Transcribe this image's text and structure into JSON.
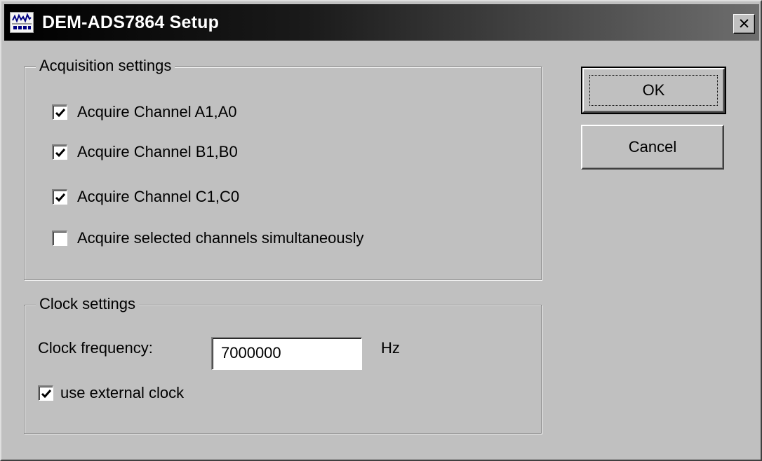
{
  "window": {
    "title": "DEM-ADS7864 Setup",
    "close_glyph": "✕"
  },
  "acquisition": {
    "legend": "Acquisition settings",
    "checkboxes": [
      {
        "label": "Acquire Channel A1,A0",
        "checked": true
      },
      {
        "label": "Acquire Channel B1,B0",
        "checked": true
      },
      {
        "label": "Acquire Channel C1,C0",
        "checked": true
      },
      {
        "label": "Acquire selected channels simultaneously",
        "checked": false
      }
    ]
  },
  "clock": {
    "legend": "Clock settings",
    "frequency_label": "Clock frequency:",
    "frequency_value": "7000000",
    "unit": "Hz",
    "external": {
      "label": "use external clock",
      "checked": true
    }
  },
  "buttons": {
    "ok": "OK",
    "cancel": "Cancel"
  }
}
